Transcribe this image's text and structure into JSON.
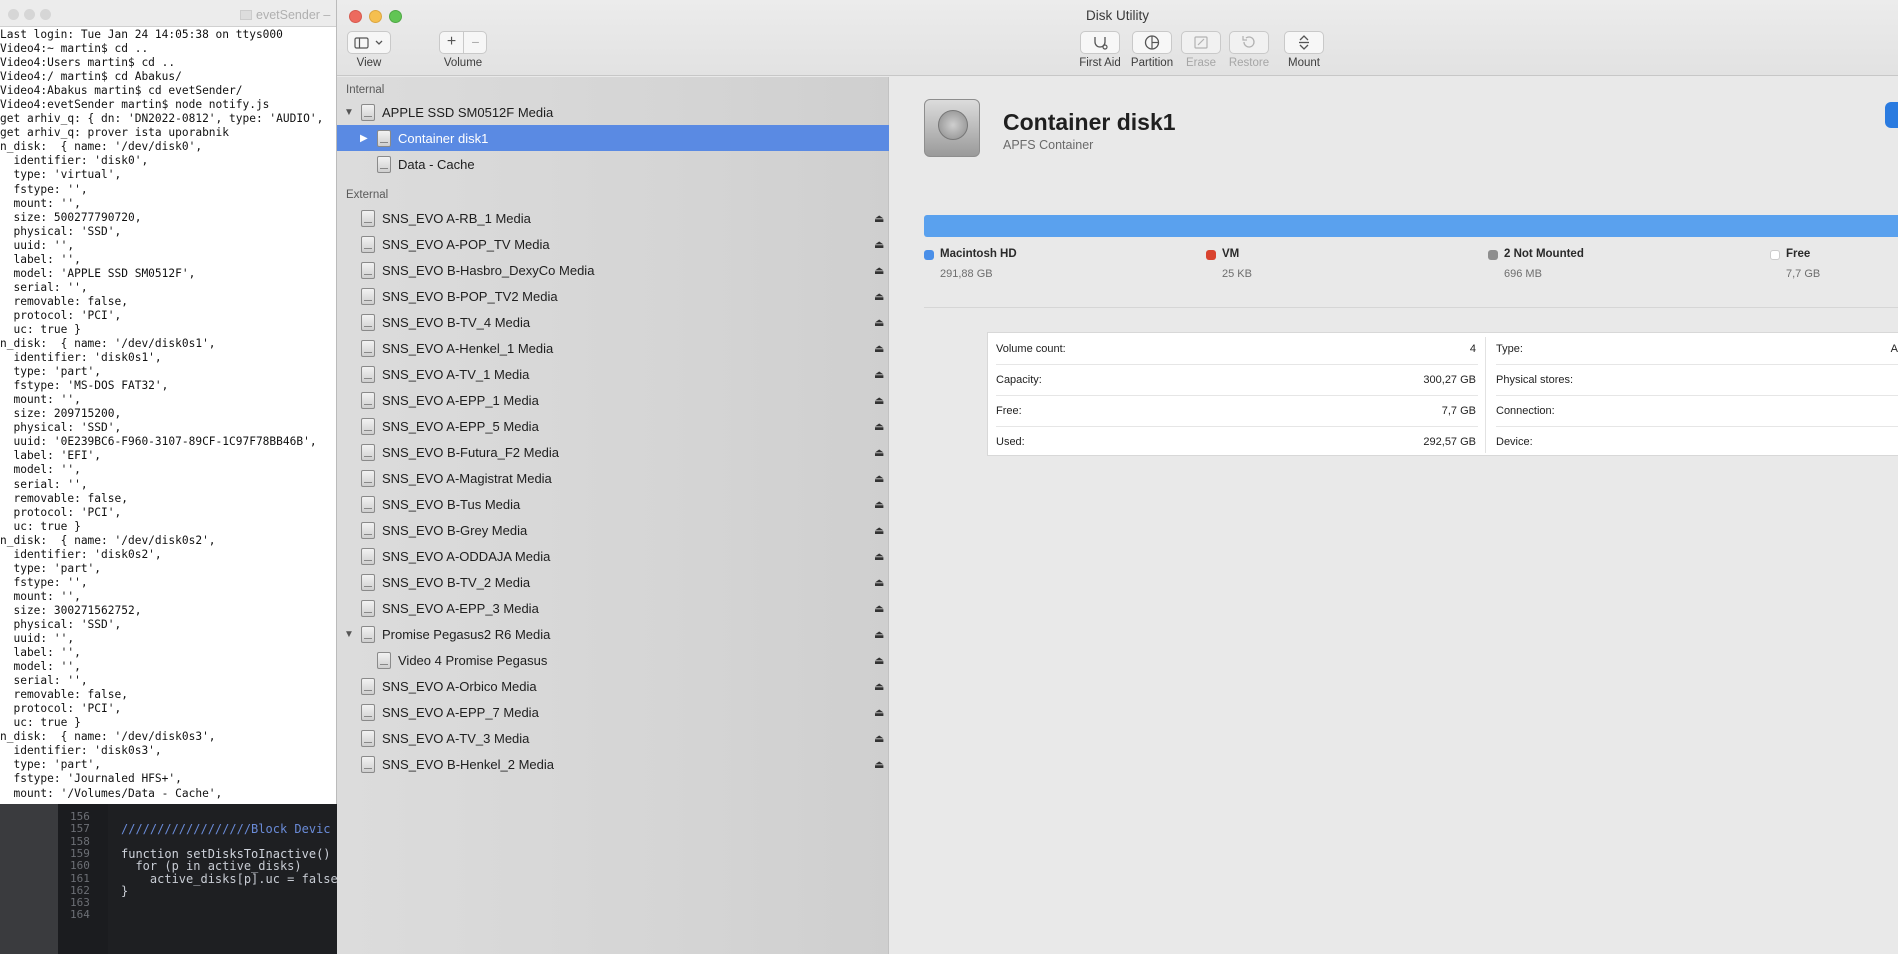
{
  "terminal": {
    "title": "evetSender",
    "lines": [
      "Last login: Tue Jan 24 14:05:38 on ttys000",
      "Video4:~ martin$ cd ..",
      "Video4:Users martin$ cd ..",
      "Video4:/ martin$ cd Abakus/",
      "Video4:Abakus martin$ cd evetSender/",
      "Video4:evetSender martin$ node notify.js",
      "get arhiv_q: { dn: 'DN2022-0812', type: 'AUDIO',",
      "get arhiv_q: prover ista uporabnik",
      "n_disk:  { name: '/dev/disk0',",
      "  identifier: 'disk0',",
      "  type: 'virtual',",
      "  fstype: '',",
      "  mount: '',",
      "  size: 500277790720,",
      "  physical: 'SSD',",
      "  uuid: '',",
      "  label: '',",
      "  model: 'APPLE SSD SM0512F',",
      "  serial: '',",
      "  removable: false,",
      "  protocol: 'PCI',",
      "  uc: true }",
      "n_disk:  { name: '/dev/disk0s1',",
      "  identifier: 'disk0s1',",
      "  type: 'part',",
      "  fstype: 'MS-DOS FAT32',",
      "  mount: '',",
      "  size: 209715200,",
      "  physical: 'SSD',",
      "  uuid: '0E239BC6-F960-3107-89CF-1C97F78BB46B',",
      "  label: 'EFI',",
      "  model: '',",
      "  serial: '',",
      "  removable: false,",
      "  protocol: 'PCI',",
      "  uc: true }",
      "n_disk:  { name: '/dev/disk0s2',",
      "  identifier: 'disk0s2',",
      "  type: 'part',",
      "  fstype: '',",
      "  mount: '',",
      "  size: 300271562752,",
      "  physical: 'SSD',",
      "  uuid: '',",
      "  label: '',",
      "  model: '',",
      "  serial: '',",
      "  removable: false,",
      "  protocol: 'PCI',",
      "  uc: true }",
      "n_disk:  { name: '/dev/disk0s3',",
      "  identifier: 'disk0s3',",
      "  type: 'part',",
      "  fstype: 'Journaled HFS+',",
      "  mount: '/Volumes/Data - Cache',"
    ]
  },
  "editor": {
    "lines": [
      {
        "num": "156",
        "code": ""
      },
      {
        "num": "157",
        "code": "//////////////////Block Devic"
      },
      {
        "num": "158",
        "code": ""
      },
      {
        "num": "159",
        "code": "function setDisksToInactive()"
      },
      {
        "num": "160",
        "code": "  for (p in active_disks)"
      },
      {
        "num": "161",
        "code": "    active_disks[p].uc = false"
      },
      {
        "num": "162",
        "code": "}"
      },
      {
        "num": "163",
        "code": ""
      },
      {
        "num": "164",
        "code": ""
      }
    ]
  },
  "window": {
    "title": "Disk Utility",
    "colors": {
      "close": "#ed6a5e",
      "minimize": "#f5bf4f",
      "zoom": "#61c554",
      "selection": "#5a8ae3"
    }
  },
  "toolbar": {
    "view_label": "View",
    "volume_label": "Volume",
    "volume_add": "+",
    "volume_remove": "−",
    "first_aid_label": "First Aid",
    "partition_label": "Partition",
    "erase_label": "Erase",
    "restore_label": "Restore",
    "mount_label": "Mount"
  },
  "sidebar": {
    "internal_label": "Internal",
    "external_label": "External",
    "internal": [
      {
        "label": "APPLE SSD SM0512F Media",
        "level": 0,
        "disclosure": "down",
        "selected": false,
        "eject": false
      },
      {
        "label": "Container disk1",
        "level": 1,
        "disclosure": "right",
        "selected": true,
        "eject": false
      },
      {
        "label": "Data - Cache",
        "level": 1,
        "disclosure": "",
        "selected": false,
        "eject": false
      }
    ],
    "external": [
      {
        "label": "SNS_EVO A-RB_1 Media",
        "level": 0,
        "disclosure": "",
        "eject": true
      },
      {
        "label": "SNS_EVO A-POP_TV Media",
        "level": 0,
        "disclosure": "",
        "eject": true
      },
      {
        "label": "SNS_EVO B-Hasbro_DexyCo Media",
        "level": 0,
        "disclosure": "",
        "eject": true
      },
      {
        "label": "SNS_EVO B-POP_TV2 Media",
        "level": 0,
        "disclosure": "",
        "eject": true
      },
      {
        "label": "SNS_EVO B-TV_4 Media",
        "level": 0,
        "disclosure": "",
        "eject": true
      },
      {
        "label": "SNS_EVO A-Henkel_1 Media",
        "level": 0,
        "disclosure": "",
        "eject": true
      },
      {
        "label": "SNS_EVO A-TV_1 Media",
        "level": 0,
        "disclosure": "",
        "eject": true
      },
      {
        "label": "SNS_EVO A-EPP_1 Media",
        "level": 0,
        "disclosure": "",
        "eject": true
      },
      {
        "label": "SNS_EVO A-EPP_5 Media",
        "level": 0,
        "disclosure": "",
        "eject": true
      },
      {
        "label": "SNS_EVO B-Futura_F2 Media",
        "level": 0,
        "disclosure": "",
        "eject": true
      },
      {
        "label": "SNS_EVO A-Magistrat Media",
        "level": 0,
        "disclosure": "",
        "eject": true
      },
      {
        "label": "SNS_EVO B-Tus Media",
        "level": 0,
        "disclosure": "",
        "eject": true
      },
      {
        "label": "SNS_EVO B-Grey Media",
        "level": 0,
        "disclosure": "",
        "eject": true
      },
      {
        "label": "SNS_EVO A-ODDAJA Media",
        "level": 0,
        "disclosure": "",
        "eject": true
      },
      {
        "label": "SNS_EVO B-TV_2 Media",
        "level": 0,
        "disclosure": "",
        "eject": true
      },
      {
        "label": "SNS_EVO A-EPP_3 Media",
        "level": 0,
        "disclosure": "",
        "eject": true
      },
      {
        "label": "Promise Pegasus2 R6 Media",
        "level": 0,
        "disclosure": "down",
        "eject": true
      },
      {
        "label": "Video 4 Promise Pegasus",
        "level": 1,
        "disclosure": "",
        "eject": true
      },
      {
        "label": "SNS_EVO A-Orbico Media",
        "level": 0,
        "disclosure": "",
        "eject": true
      },
      {
        "label": "SNS_EVO A-EPP_7 Media",
        "level": 0,
        "disclosure": "",
        "eject": true
      },
      {
        "label": "SNS_EVO A-TV_3 Media",
        "level": 0,
        "disclosure": "",
        "eject": true
      },
      {
        "label": "SNS_EVO B-Henkel_2 Media",
        "level": 0,
        "disclosure": "",
        "eject": true
      }
    ]
  },
  "main": {
    "title": "Container disk1",
    "subtitle": "APFS Container",
    "usage_bar_color": "#5aa1ee",
    "legend": [
      {
        "name": "Macintosh HD",
        "size": "291,88 GB",
        "color": "#4a8fe8"
      },
      {
        "name": "VM",
        "size": "25 KB",
        "color": "#d9432f"
      },
      {
        "name": "2 Not Mounted",
        "size": "696 MB",
        "color": "#8e8e8e"
      },
      {
        "name": "Free",
        "size": "7,7 GB",
        "color": "#ffffff"
      }
    ],
    "info_left": [
      {
        "label": "Volume count:",
        "value": "4"
      },
      {
        "label": "Capacity:",
        "value": "300,27 GB"
      },
      {
        "label": "Free:",
        "value": "7,7 GB"
      },
      {
        "label": "Used:",
        "value": "292,57 GB"
      }
    ],
    "info_right": [
      {
        "label": "Type:",
        "value": "A"
      },
      {
        "label": "Physical stores:",
        "value": ""
      },
      {
        "label": "Connection:",
        "value": ""
      },
      {
        "label": "Device:",
        "value": ""
      }
    ]
  }
}
